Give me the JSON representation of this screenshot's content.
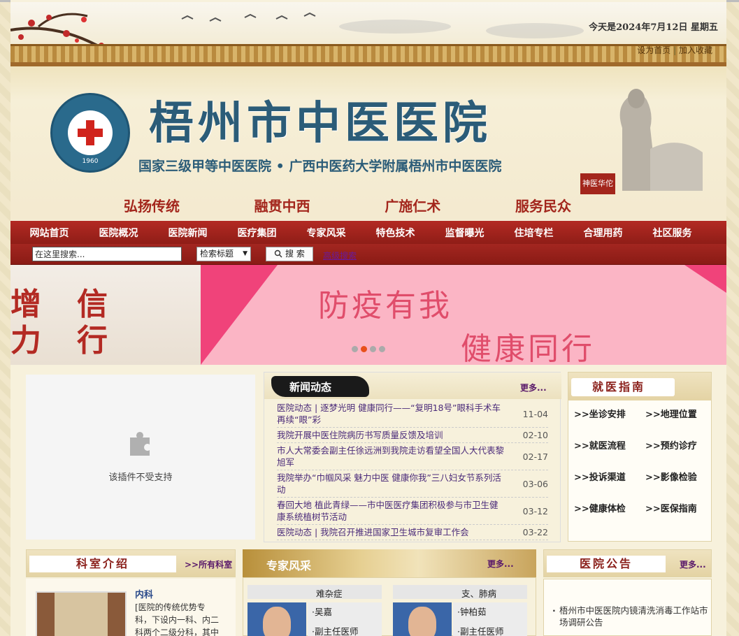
{
  "header": {
    "date_text": "今天是2024年7月12日  星期五",
    "top_links": [
      "设为首页",
      "加入收藏"
    ],
    "title": "梧州市中医医院",
    "subtitle": "国家三级甲等中医医院 • 广西中医药大学附属梧州市中医医院",
    "slogans": [
      "弘扬传统",
      "融贯中西",
      "广施仁术",
      "服务民众"
    ],
    "logo_year": "1960",
    "statue_label": "神医华佗"
  },
  "nav": {
    "items": [
      "网站首页",
      "医院概况",
      "医院新闻",
      "医疗集团",
      "专家风采",
      "特色技术",
      "监督曝光",
      "住培专栏",
      "合理用药",
      "社区服务"
    ]
  },
  "search": {
    "placeholder": "在这里搜索...",
    "select_value": "检索标题",
    "button_label": "搜 索",
    "advanced_label": "高级搜索"
  },
  "banner": {
    "left_chars": [
      "增",
      "信",
      "力",
      "行"
    ],
    "line1": "防疫有我",
    "line2": "健康同行",
    "slides": 4,
    "active_slide": 2
  },
  "plugin": {
    "message": "该插件不受支持"
  },
  "news": {
    "title": "新闻动态",
    "more": "更多...",
    "items": [
      {
        "text": "医院动态 | 逐梦光明 健康同行——“复明18号”眼科手术车再续“眼”彩",
        "date": "11-04"
      },
      {
        "text": "我院开展中医住院病历书写质量反馈及培训",
        "date": "02-10"
      },
      {
        "text": "市人大常委会副主任徐远洲到我院走访看望全国人大代表黎旭军",
        "date": "02-17"
      },
      {
        "text": "我院举办“巾帼风采 魅力中医 健康你我”三八妇女节系列活动",
        "date": "03-06"
      },
      {
        "text": "春回大地 植此青绿——市中医医疗集团积极参与市卫生健康系统植树节活动",
        "date": "03-12"
      },
      {
        "text": "医院动态 | 我院召开推进国家卫生城市复审工作会",
        "date": "03-22"
      }
    ]
  },
  "guide": {
    "title": "就医指南",
    "items": [
      ">>坐诊安排",
      ">>地理位置",
      ">>就医流程",
      ">>预约诊疗",
      ">>投诉渠道",
      ">>影像检验",
      ">>健康体检",
      ">>医保指南"
    ]
  },
  "dept": {
    "title": "科室介绍",
    "all_link": ">>所有科室",
    "name": "内科",
    "desc": "[医院的传统优势专科，下设内一科、内二科两个二级分科，其中内一"
  },
  "expert": {
    "title": "专家风采",
    "more": "更多...",
    "cards": [
      {
        "specialty": "难杂症",
        "name": "·吴嘉",
        "role": "·副主任医师"
      },
      {
        "specialty": "支、肺病",
        "name": "·钟柏茹",
        "role": "·副主任医师"
      }
    ]
  },
  "notice": {
    "title": "医院公告",
    "more": "更多...",
    "items": [
      "梧州市中医医院内镜清洗消毒工作站市场调研公告"
    ]
  },
  "colors": {
    "nav_red": "#b32a23",
    "title_blue": "#2b5c78",
    "banner_pink": "#fbb5c5",
    "accent_magenta": "#f0437a"
  }
}
